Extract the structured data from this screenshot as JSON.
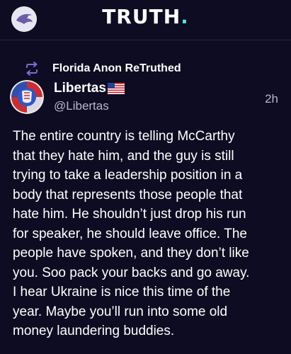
{
  "header": {
    "logo_main": "TRUTH",
    "logo_dot": ".",
    "logo_dot_color": "#5be0c8",
    "background_color": "#0e0c22"
  },
  "retruth": {
    "icon": "retruth-icon",
    "text": "Florida Anon ReTruthed"
  },
  "post": {
    "display_name": "Libertas",
    "name_badge": "us-flag-icon",
    "handle": "@Libertas",
    "time": "2h",
    "text": "The entire country is telling McCarthy\nthat they hate him, and the guy is still\ntrying to take a leadership position in a\nbody that represents those people that\nhate him. He shouldn’t just drop his run\nfor speaker, he should leave office. The\npeople have spoken, and they don’t like\nyou. Soo pack your backs and go away.\nI hear Ukraine is nice this time of the\nyear. Maybe you’ll run into some old\nmoney laundering buddies."
  }
}
